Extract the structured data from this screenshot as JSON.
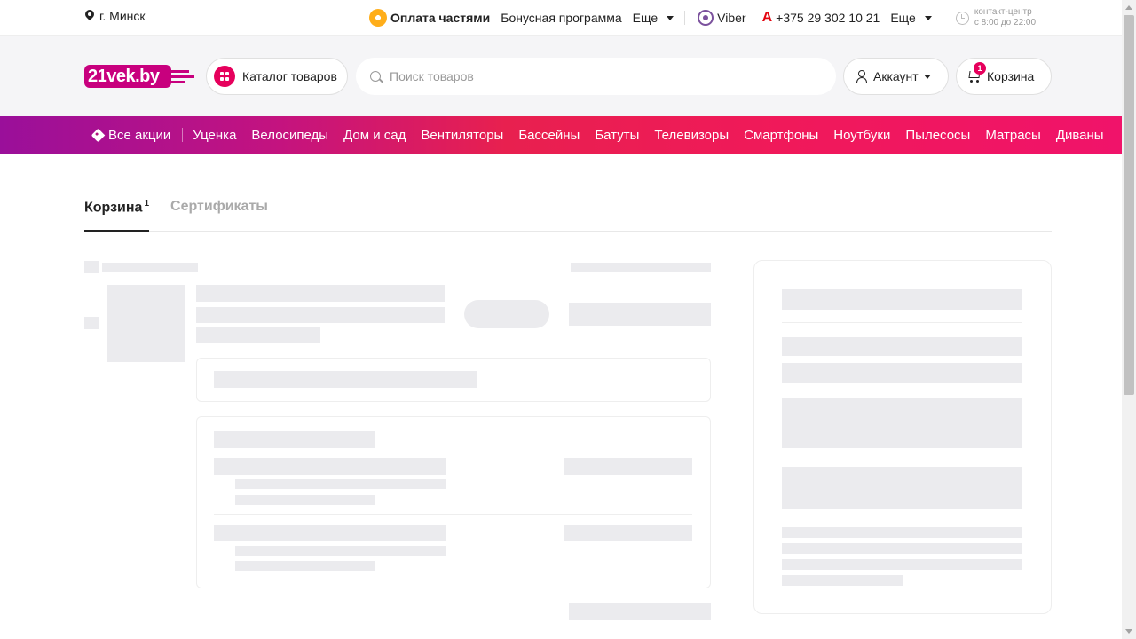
{
  "topbar": {
    "city": "г. Минск",
    "pay_parts": "Оплата частями",
    "bonus": "Бонусная программа",
    "more1": "Еще",
    "viber": "Viber",
    "phone": "+375 29 302 10 21",
    "more2": "Еще",
    "contact_line1": "контакт-центр",
    "contact_line2": "с 8:00 до 22:00"
  },
  "header": {
    "logo_text": "21vek.by",
    "catalog_label": "Каталог товаров",
    "search_placeholder": "Поиск товаров",
    "account_label": "Аккаунт",
    "cart_label": "Корзина",
    "cart_count": "1"
  },
  "promo_nav": {
    "items": [
      "Все акции",
      "Уценка",
      "Велосипеды",
      "Дом и сад",
      "Вентиляторы",
      "Бассейны",
      "Батуты",
      "Телевизоры",
      "Смартфоны",
      "Ноутбуки",
      "Пылесосы",
      "Матрасы",
      "Диваны"
    ]
  },
  "tabs": {
    "cart": "Корзина",
    "cart_count": "1",
    "certificates": "Сертификаты"
  },
  "colors": {
    "brand": "#c8007e",
    "accent": "#e6005c",
    "skeleton": "#ebebee"
  }
}
